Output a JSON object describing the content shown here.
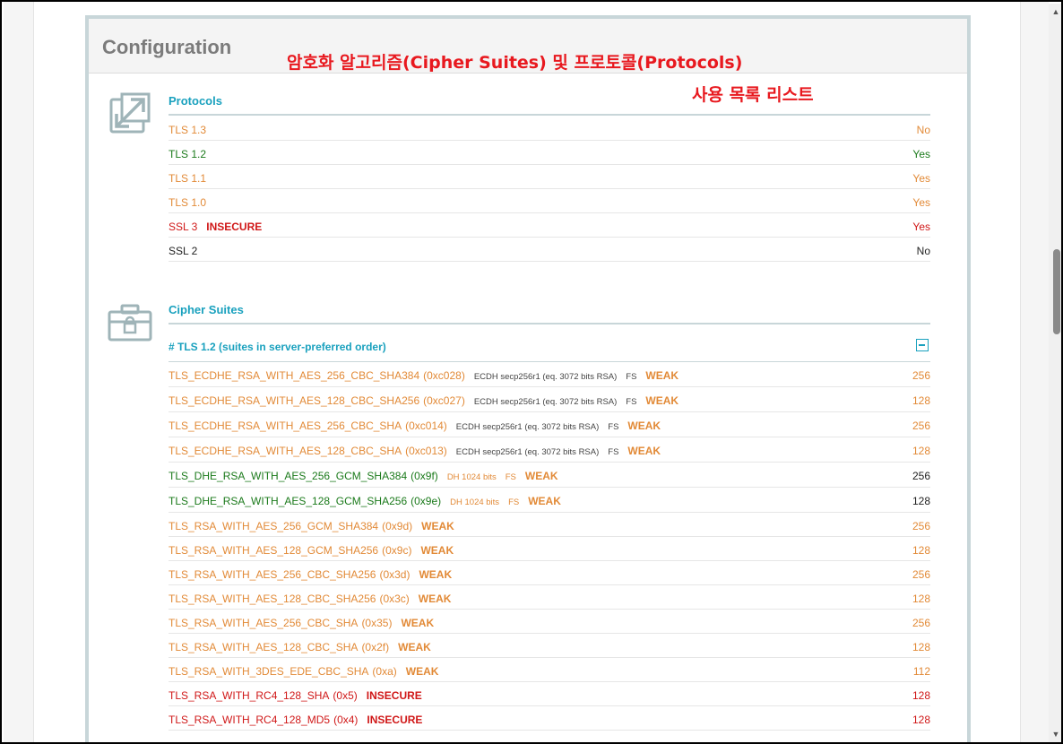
{
  "card": {
    "title": "Configuration"
  },
  "annotations": {
    "line1": "암호화 알고리즘(Cipher Suites) 및 프로토콜(Protocols)",
    "line2": "사용 목록 리스트"
  },
  "protocols": {
    "title": "Protocols",
    "icon": "resize-arrows-icon",
    "rows": [
      {
        "name": "TLS 1.3",
        "tag": "",
        "value": "No",
        "color": "#e28a37"
      },
      {
        "name": "TLS 1.2",
        "tag": "",
        "value": "Yes",
        "color": "#1b7a1b"
      },
      {
        "name": "TLS 1.1",
        "tag": "",
        "value": "Yes",
        "color": "#e28a37"
      },
      {
        "name": "TLS 1.0",
        "tag": "",
        "value": "Yes",
        "color": "#e28a37"
      },
      {
        "name": "SSL 3",
        "tag": "INSECURE",
        "value": "Yes",
        "color": "#d01818"
      },
      {
        "name": "SSL 2",
        "tag": "",
        "value": "No",
        "color": "#222222"
      }
    ]
  },
  "cipher_suites": {
    "title": "Cipher Suites",
    "icon": "toolbox-lock-icon",
    "subheader": "# TLS 1.2 (suites in server-preferred order)",
    "collapse_icon": "collapse-minus-icon",
    "rows": [
      {
        "name": "TLS_ECDHE_RSA_WITH_AES_256_CBC_SHA384",
        "code": "(0xc028)",
        "kx": "ECDH secp256r1 (eq. 3072 bits RSA)",
        "fs": "FS",
        "tag": "WEAK",
        "bits": "256",
        "color": "#e28a37"
      },
      {
        "name": "TLS_ECDHE_RSA_WITH_AES_128_CBC_SHA256",
        "code": "(0xc027)",
        "kx": "ECDH secp256r1 (eq. 3072 bits RSA)",
        "fs": "FS",
        "tag": "WEAK",
        "bits": "128",
        "color": "#e28a37"
      },
      {
        "name": "TLS_ECDHE_RSA_WITH_AES_256_CBC_SHA",
        "code": "(0xc014)",
        "kx": "ECDH secp256r1 (eq. 3072 bits RSA)",
        "fs": "FS",
        "tag": "WEAK",
        "bits": "256",
        "color": "#e28a37"
      },
      {
        "name": "TLS_ECDHE_RSA_WITH_AES_128_CBC_SHA",
        "code": "(0xc013)",
        "kx": "ECDH secp256r1 (eq. 3072 bits RSA)",
        "fs": "FS",
        "tag": "WEAK",
        "bits": "128",
        "color": "#e28a37"
      },
      {
        "name": "TLS_DHE_RSA_WITH_AES_256_GCM_SHA384",
        "code": "(0x9f)",
        "kx": "DH 1024 bits",
        "fs": "FS",
        "tag": "WEAK",
        "bits": "256",
        "color": "#1b7a1b"
      },
      {
        "name": "TLS_DHE_RSA_WITH_AES_128_GCM_SHA256",
        "code": "(0x9e)",
        "kx": "DH 1024 bits",
        "fs": "FS",
        "tag": "WEAK",
        "bits": "128",
        "color": "#1b7a1b"
      },
      {
        "name": "TLS_RSA_WITH_AES_256_GCM_SHA384",
        "code": "(0x9d)",
        "kx": "",
        "fs": "",
        "tag": "WEAK",
        "bits": "256",
        "color": "#e28a37"
      },
      {
        "name": "TLS_RSA_WITH_AES_128_GCM_SHA256",
        "code": "(0x9c)",
        "kx": "",
        "fs": "",
        "tag": "WEAK",
        "bits": "128",
        "color": "#e28a37"
      },
      {
        "name": "TLS_RSA_WITH_AES_256_CBC_SHA256",
        "code": "(0x3d)",
        "kx": "",
        "fs": "",
        "tag": "WEAK",
        "bits": "256",
        "color": "#e28a37"
      },
      {
        "name": "TLS_RSA_WITH_AES_128_CBC_SHA256",
        "code": "(0x3c)",
        "kx": "",
        "fs": "",
        "tag": "WEAK",
        "bits": "128",
        "color": "#e28a37"
      },
      {
        "name": "TLS_RSA_WITH_AES_256_CBC_SHA",
        "code": "(0x35)",
        "kx": "",
        "fs": "",
        "tag": "WEAK",
        "bits": "256",
        "color": "#e28a37"
      },
      {
        "name": "TLS_RSA_WITH_AES_128_CBC_SHA",
        "code": "(0x2f)",
        "kx": "",
        "fs": "",
        "tag": "WEAK",
        "bits": "128",
        "color": "#e28a37"
      },
      {
        "name": "TLS_RSA_WITH_3DES_EDE_CBC_SHA",
        "code": "(0xa)",
        "kx": "",
        "fs": "",
        "tag": "WEAK",
        "bits": "112",
        "color": "#e28a37"
      },
      {
        "name": "TLS_RSA_WITH_RC4_128_SHA",
        "code": "(0x5)",
        "kx": "",
        "fs": "",
        "tag": "INSECURE",
        "bits": "128",
        "color": "#d01818"
      },
      {
        "name": "TLS_RSA_WITH_RC4_128_MD5",
        "code": "(0x4)",
        "kx": "",
        "fs": "",
        "tag": "INSECURE",
        "bits": "128",
        "color": "#d01818"
      }
    ]
  },
  "scrollbar": {
    "up_icon": "scroll-up-arrow-icon",
    "down_icon": "scroll-down-arrow-icon"
  }
}
